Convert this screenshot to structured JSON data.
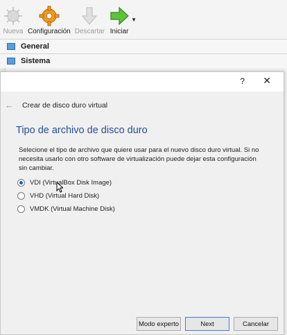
{
  "toolbar": {
    "items": [
      {
        "label": "Nueva",
        "icon": "new-sun-icon",
        "enabled": false
      },
      {
        "label": "Configuración",
        "icon": "gear-icon",
        "enabled": true
      },
      {
        "label": "Descartar",
        "icon": "discard-arrow-icon",
        "enabled": false
      },
      {
        "label": "Iniciar",
        "icon": "start-arrow-icon",
        "enabled": true
      }
    ]
  },
  "sections": [
    "General",
    "Sistema"
  ],
  "dialog": {
    "help": "?",
    "close": "✕",
    "back_icon": "←",
    "nav_title": "Crear de disco duro virtual",
    "heading": "Tipo de archivo de disco duro",
    "description": "Selecione el tipo de archivo que quiere usar para el nuevo disco duro virtual. Si no necesita usarlo con otro software de virtualización puede dejar esta configuración sin cambiar.",
    "options": [
      {
        "label": "VDI (VirtualBox Disk Image)",
        "selected": true
      },
      {
        "label": "VHD (Virtual Hard Disk)",
        "selected": false
      },
      {
        "label": "VMDK (Virtual Machine Disk)",
        "selected": false
      }
    ],
    "buttons": {
      "expert": "Modo experto",
      "next": "Next",
      "cancel": "Cancelar"
    }
  },
  "colors": {
    "heading": "#1f4e9c",
    "radio_selected": "#1a5fb4",
    "section_icon": "#5d9ddc"
  }
}
